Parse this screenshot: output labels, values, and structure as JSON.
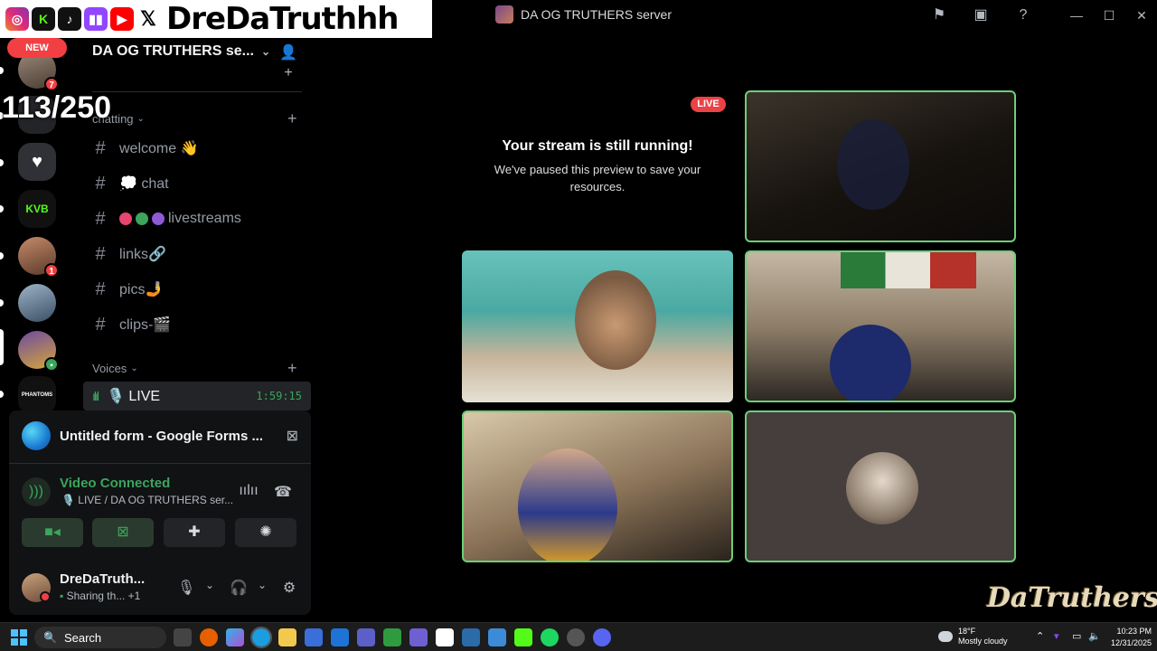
{
  "window": {
    "title": "DA OG TRUTHERS server",
    "icons": [
      "flag-icon",
      "inbox-icon",
      "help-icon"
    ],
    "controls": [
      "minimize-icon",
      "maximize-icon",
      "close-icon"
    ]
  },
  "overlay": {
    "name": "DreDaTruthhh",
    "socials": [
      "instagram-icon",
      "kick-icon",
      "tiktok-icon",
      "twitch-icon",
      "youtube-icon",
      "x-icon"
    ],
    "counter": "113/250"
  },
  "rail": {
    "new_label": "NEW",
    "servers": [
      {
        "name": "server-1",
        "badge": "7"
      },
      {
        "name": "server-2",
        "badge": ""
      },
      {
        "name": "server-3",
        "badge": ""
      },
      {
        "name": "server-kvb",
        "label": "KVB",
        "badge": ""
      },
      {
        "name": "server-5",
        "badge": "1"
      },
      {
        "name": "server-6",
        "badge": ""
      },
      {
        "name": "server-7",
        "badge": ""
      },
      {
        "name": "server-phantoms",
        "label": "PHANTOMS",
        "badge": ""
      }
    ]
  },
  "sidebar": {
    "server_name": "DA OG TRUTHERS se...",
    "category_chatting": "chatting",
    "channels": [
      {
        "name": "welcome 👋"
      },
      {
        "name": "💭 chat"
      },
      {
        "name": "livestreams"
      },
      {
        "name": "links🔗"
      },
      {
        "name": "pics🤳"
      },
      {
        "name": "clips-🎬"
      }
    ],
    "category_voices": "Voices",
    "voice_channel": {
      "name": "🎙️ LIVE",
      "timer": "1:59:15"
    }
  },
  "panel": {
    "share_title": "Untitled form - Google Forms ...",
    "voice_status": "Video Connected",
    "voice_location": "🎙️ LIVE / DA OG TRUTHERS ser...",
    "user_name": "DreDaTruth...",
    "user_status": "Sharing th...",
    "user_status_extra": "+1"
  },
  "stage": {
    "live_label": "LIVE",
    "paused_title": "Your stream is still running!",
    "paused_sub": "We've paused this preview to save your resources.",
    "watermark": "DaTruthers"
  },
  "taskbar": {
    "search_placeholder": "Search",
    "weather_temp": "18°F",
    "weather_desc": "Mostly cloudy",
    "time": "10:23 PM",
    "date": "12/31/2025"
  },
  "colors": {
    "accent_green": "#3ba55c",
    "speaking_border": "#6ccf7a",
    "live_red": "#ed4245",
    "badge_red": "#f23f43"
  }
}
